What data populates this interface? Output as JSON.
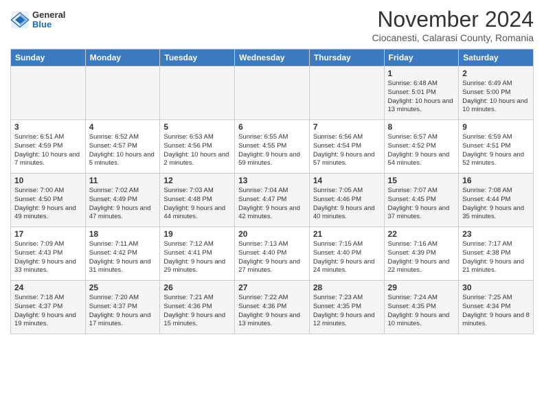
{
  "header": {
    "logo": {
      "general": "General",
      "blue": "Blue"
    },
    "title": "November 2024",
    "subtitle": "Ciocanesti, Calarasi County, Romania"
  },
  "columns": [
    "Sunday",
    "Monday",
    "Tuesday",
    "Wednesday",
    "Thursday",
    "Friday",
    "Saturday"
  ],
  "weeks": [
    [
      {
        "day": "",
        "info": ""
      },
      {
        "day": "",
        "info": ""
      },
      {
        "day": "",
        "info": ""
      },
      {
        "day": "",
        "info": ""
      },
      {
        "day": "",
        "info": ""
      },
      {
        "day": "1",
        "info": "Sunrise: 6:48 AM\nSunset: 5:01 PM\nDaylight: 10 hours and 13 minutes."
      },
      {
        "day": "2",
        "info": "Sunrise: 6:49 AM\nSunset: 5:00 PM\nDaylight: 10 hours and 10 minutes."
      }
    ],
    [
      {
        "day": "3",
        "info": "Sunrise: 6:51 AM\nSunset: 4:59 PM\nDaylight: 10 hours and 7 minutes."
      },
      {
        "day": "4",
        "info": "Sunrise: 6:52 AM\nSunset: 4:57 PM\nDaylight: 10 hours and 5 minutes."
      },
      {
        "day": "5",
        "info": "Sunrise: 6:53 AM\nSunset: 4:56 PM\nDaylight: 10 hours and 2 minutes."
      },
      {
        "day": "6",
        "info": "Sunrise: 6:55 AM\nSunset: 4:55 PM\nDaylight: 9 hours and 59 minutes."
      },
      {
        "day": "7",
        "info": "Sunrise: 6:56 AM\nSunset: 4:54 PM\nDaylight: 9 hours and 57 minutes."
      },
      {
        "day": "8",
        "info": "Sunrise: 6:57 AM\nSunset: 4:52 PM\nDaylight: 9 hours and 54 minutes."
      },
      {
        "day": "9",
        "info": "Sunrise: 6:59 AM\nSunset: 4:51 PM\nDaylight: 9 hours and 52 minutes."
      }
    ],
    [
      {
        "day": "10",
        "info": "Sunrise: 7:00 AM\nSunset: 4:50 PM\nDaylight: 9 hours and 49 minutes."
      },
      {
        "day": "11",
        "info": "Sunrise: 7:02 AM\nSunset: 4:49 PM\nDaylight: 9 hours and 47 minutes."
      },
      {
        "day": "12",
        "info": "Sunrise: 7:03 AM\nSunset: 4:48 PM\nDaylight: 9 hours and 44 minutes."
      },
      {
        "day": "13",
        "info": "Sunrise: 7:04 AM\nSunset: 4:47 PM\nDaylight: 9 hours and 42 minutes."
      },
      {
        "day": "14",
        "info": "Sunrise: 7:05 AM\nSunset: 4:46 PM\nDaylight: 9 hours and 40 minutes."
      },
      {
        "day": "15",
        "info": "Sunrise: 7:07 AM\nSunset: 4:45 PM\nDaylight: 9 hours and 37 minutes."
      },
      {
        "day": "16",
        "info": "Sunrise: 7:08 AM\nSunset: 4:44 PM\nDaylight: 9 hours and 35 minutes."
      }
    ],
    [
      {
        "day": "17",
        "info": "Sunrise: 7:09 AM\nSunset: 4:43 PM\nDaylight: 9 hours and 33 minutes."
      },
      {
        "day": "18",
        "info": "Sunrise: 7:11 AM\nSunset: 4:42 PM\nDaylight: 9 hours and 31 minutes."
      },
      {
        "day": "19",
        "info": "Sunrise: 7:12 AM\nSunset: 4:41 PM\nDaylight: 9 hours and 29 minutes."
      },
      {
        "day": "20",
        "info": "Sunrise: 7:13 AM\nSunset: 4:40 PM\nDaylight: 9 hours and 27 minutes."
      },
      {
        "day": "21",
        "info": "Sunrise: 7:15 AM\nSunset: 4:40 PM\nDaylight: 9 hours and 24 minutes."
      },
      {
        "day": "22",
        "info": "Sunrise: 7:16 AM\nSunset: 4:39 PM\nDaylight: 9 hours and 22 minutes."
      },
      {
        "day": "23",
        "info": "Sunrise: 7:17 AM\nSunset: 4:38 PM\nDaylight: 9 hours and 21 minutes."
      }
    ],
    [
      {
        "day": "24",
        "info": "Sunrise: 7:18 AM\nSunset: 4:37 PM\nDaylight: 9 hours and 19 minutes."
      },
      {
        "day": "25",
        "info": "Sunrise: 7:20 AM\nSunset: 4:37 PM\nDaylight: 9 hours and 17 minutes."
      },
      {
        "day": "26",
        "info": "Sunrise: 7:21 AM\nSunset: 4:36 PM\nDaylight: 9 hours and 15 minutes."
      },
      {
        "day": "27",
        "info": "Sunrise: 7:22 AM\nSunset: 4:36 PM\nDaylight: 9 hours and 13 minutes."
      },
      {
        "day": "28",
        "info": "Sunrise: 7:23 AM\nSunset: 4:35 PM\nDaylight: 9 hours and 12 minutes."
      },
      {
        "day": "29",
        "info": "Sunrise: 7:24 AM\nSunset: 4:35 PM\nDaylight: 9 hours and 10 minutes."
      },
      {
        "day": "30",
        "info": "Sunrise: 7:25 AM\nSunset: 4:34 PM\nDaylight: 9 hours and 8 minutes."
      }
    ]
  ]
}
